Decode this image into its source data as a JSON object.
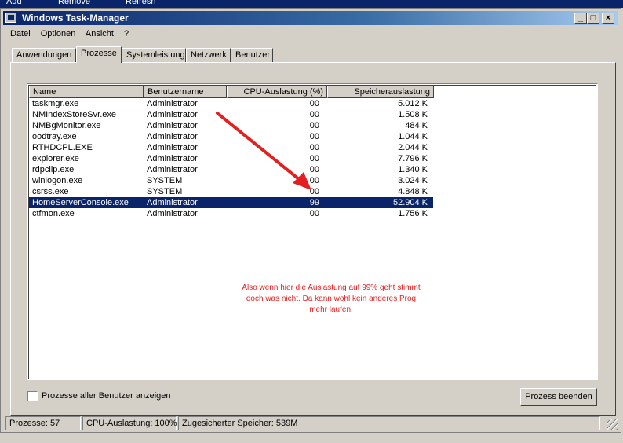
{
  "topbar": {
    "items": [
      "Add",
      "Remove",
      "Refresh"
    ]
  },
  "window": {
    "title": "Windows Task-Manager",
    "controls": {
      "minimize": "_",
      "maximize": "□",
      "close": "×"
    }
  },
  "menu": [
    "Datei",
    "Optionen",
    "Ansicht",
    "?"
  ],
  "tabs": [
    "Anwendungen",
    "Prozesse",
    "Systemleistung",
    "Netzwerk",
    "Benutzer"
  ],
  "active_tab": "Prozesse",
  "table": {
    "columns": [
      "Name",
      "Benutzername",
      "CPU-Auslastung (%)",
      "Speicherauslastung"
    ],
    "rows": [
      [
        "taskmgr.exe",
        "Administrator",
        "00",
        "5.012 K"
      ],
      [
        "NMIndexStoreSvr.exe",
        "Administrator",
        "00",
        "1.508 K"
      ],
      [
        "NMBgMonitor.exe",
        "Administrator",
        "00",
        "484 K"
      ],
      [
        "oodtray.exe",
        "Administrator",
        "00",
        "1.044 K"
      ],
      [
        "RTHDCPL.EXE",
        "Administrator",
        "00",
        "2.044 K"
      ],
      [
        "explorer.exe",
        "Administrator",
        "00",
        "7.796 K"
      ],
      [
        "rdpclip.exe",
        "Administrator",
        "00",
        "1.340 K"
      ],
      [
        "winlogon.exe",
        "SYSTEM",
        "00",
        "3.024 K"
      ],
      [
        "csrss.exe",
        "SYSTEM",
        "00",
        "4.848 K"
      ],
      [
        "HomeServerConsole.exe",
        "Administrator",
        "99",
        "52.904 K"
      ],
      [
        "ctfmon.exe",
        "Administrator",
        "00",
        "1.756 K"
      ]
    ],
    "selected_row": "HomeServerConsole.exe"
  },
  "annotation": {
    "text": "Also wenn hier die Auslastung auf 99% geht stimmt doch was nicht. Da kann wohl kein anderes Prog mehr laufen.",
    "color": "#e41f1f"
  },
  "checkbox": {
    "label": "Prozesse aller Benutzer anzeigen",
    "checked": false
  },
  "end_button": {
    "label": "Prozess beenden"
  },
  "status": {
    "processes": "Prozesse: 57",
    "cpu": "CPU-Auslastung: 100%",
    "memory": "Zugesicherter Speicher: 539M"
  },
  "colors": {
    "selection": "#0a246a",
    "titlebar": "#0a246a",
    "face": "#d4d0c8",
    "annotation": "#e41f1f"
  }
}
